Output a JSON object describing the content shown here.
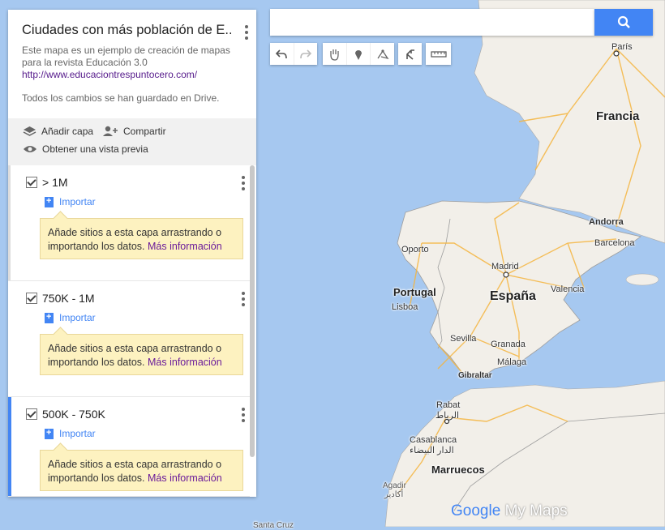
{
  "panel": {
    "title": "Ciudades con más población de E...",
    "description": "Este mapa es un ejemplo de creación de mapas para la revista Educación 3.0",
    "link": "http://www.educaciontrespuntocero.com/",
    "saved_status": "Todos los cambios se han guardado en Drive.",
    "actions": {
      "add_layer": "Añadir capa",
      "share": "Compartir",
      "preview": "Obtener una vista previa"
    },
    "layers": [
      {
        "name": "> 1M",
        "import": "Importar",
        "tip": "Añade sitios a esta capa arrastrando o importando los datos.",
        "more": "Más información"
      },
      {
        "name": "750K - 1M",
        "import": "Importar",
        "tip": "Añade sitios a esta capa arrastrando o importando los datos.",
        "more": "Más información"
      },
      {
        "name": "500K - 750K",
        "import": "Importar",
        "tip": "Añade sitios a esta capa arrastrando o importando los datos.",
        "more": "Más información"
      }
    ]
  },
  "search": {
    "placeholder": "",
    "button_icon": "search-icon"
  },
  "toolbar": {
    "icons": [
      "undo-icon",
      "redo-icon",
      "hand-icon",
      "marker-icon",
      "draw-line-icon",
      "directions-icon",
      "ruler-icon"
    ]
  },
  "map": {
    "countries": {
      "france": "Francia",
      "spain": "España",
      "portugal": "Portugal",
      "morocco": "Marruecos"
    },
    "cities": {
      "paris": "París",
      "andorra": "Andorra",
      "barcelona": "Barcelona",
      "oporto": "Oporto",
      "madrid": "Madrid",
      "valencia": "Valencia",
      "lisboa": "Lisboa",
      "sevilla": "Sevilla",
      "granada": "Granada",
      "malaga": "Málaga",
      "gibraltar": "Gibraltar",
      "rabat": "Rabat",
      "rabat_ar": "الرباط",
      "casablanca": "Casablanca",
      "casablanca_ar": "الدار البيضاء",
      "agadir": "Agadir",
      "agadir_ar": "أكادير",
      "santa_cruz": "Santa Cruz"
    },
    "logo_google": "Google",
    "logo_mymaps": "My Maps",
    "colors": {
      "water": "#a6c8f0",
      "land": "#f2efe9",
      "roads": "#f5b53f",
      "accent": "#4285f4"
    }
  }
}
